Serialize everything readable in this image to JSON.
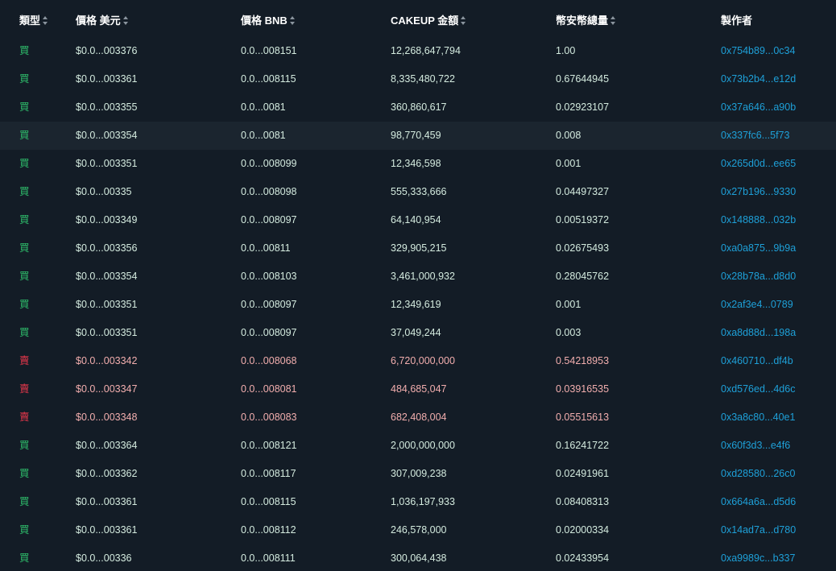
{
  "header": {
    "type": "類型",
    "price_usd": "價格 美元",
    "price_bnb": "價格 BNB",
    "amount": "CAKEUP 金額",
    "total_bnb": "幣安幣總量",
    "maker": "製作者"
  },
  "colors": {
    "background": "#131c26",
    "row_highlight": "#1b252f",
    "buy": "#2ebd6b",
    "buy_text": "#d4ebdf",
    "sell": "#e0364a",
    "sell_text": "#f2aeae",
    "link": "#1ea0d8"
  },
  "icons": {
    "sort": "sort-arrows-icon"
  },
  "trades": [
    {
      "side": "buy",
      "type": "買",
      "price_usd": "$0.0...003376",
      "price_bnb": "0.0...008151",
      "amount": "12,268,647,794",
      "total_bnb": "1.00",
      "maker": "0x754b89...0c34"
    },
    {
      "side": "buy",
      "type": "買",
      "price_usd": "$0.0...003361",
      "price_bnb": "0.0...008115",
      "amount": "8,335,480,722",
      "total_bnb": "0.67644945",
      "maker": "0x73b2b4...e12d"
    },
    {
      "side": "buy",
      "type": "買",
      "price_usd": "$0.0...003355",
      "price_bnb": "0.0...0081",
      "amount": "360,860,617",
      "total_bnb": "0.02923107",
      "maker": "0x37a646...a90b"
    },
    {
      "side": "buy",
      "type": "買",
      "price_usd": "$0.0...003354",
      "price_bnb": "0.0...0081",
      "amount": "98,770,459",
      "total_bnb": "0.008",
      "maker": "0x337fc6...5f73",
      "highlight": true
    },
    {
      "side": "buy",
      "type": "買",
      "price_usd": "$0.0...003351",
      "price_bnb": "0.0...008099",
      "amount": "12,346,598",
      "total_bnb": "0.001",
      "maker": "0x265d0d...ee65"
    },
    {
      "side": "buy",
      "type": "買",
      "price_usd": "$0.0...00335",
      "price_bnb": "0.0...008098",
      "amount": "555,333,666",
      "total_bnb": "0.04497327",
      "maker": "0x27b196...9330"
    },
    {
      "side": "buy",
      "type": "買",
      "price_usd": "$0.0...003349",
      "price_bnb": "0.0...008097",
      "amount": "64,140,954",
      "total_bnb": "0.00519372",
      "maker": "0x148888...032b"
    },
    {
      "side": "buy",
      "type": "買",
      "price_usd": "$0.0...003356",
      "price_bnb": "0.0...00811",
      "amount": "329,905,215",
      "total_bnb": "0.02675493",
      "maker": "0xa0a875...9b9a"
    },
    {
      "side": "buy",
      "type": "買",
      "price_usd": "$0.0...003354",
      "price_bnb": "0.0...008103",
      "amount": "3,461,000,932",
      "total_bnb": "0.28045762",
      "maker": "0x28b78a...d8d0"
    },
    {
      "side": "buy",
      "type": "買",
      "price_usd": "$0.0...003351",
      "price_bnb": "0.0...008097",
      "amount": "12,349,619",
      "total_bnb": "0.001",
      "maker": "0x2af3e4...0789"
    },
    {
      "side": "buy",
      "type": "買",
      "price_usd": "$0.0...003351",
      "price_bnb": "0.0...008097",
      "amount": "37,049,244",
      "total_bnb": "0.003",
      "maker": "0xa8d88d...198a"
    },
    {
      "side": "sell",
      "type": "賣",
      "price_usd": "$0.0...003342",
      "price_bnb": "0.0...008068",
      "amount": "6,720,000,000",
      "total_bnb": "0.54218953",
      "maker": "0x460710...df4b"
    },
    {
      "side": "sell",
      "type": "賣",
      "price_usd": "$0.0...003347",
      "price_bnb": "0.0...008081",
      "amount": "484,685,047",
      "total_bnb": "0.03916535",
      "maker": "0xd576ed...4d6c"
    },
    {
      "side": "sell",
      "type": "賣",
      "price_usd": "$0.0...003348",
      "price_bnb": "0.0...008083",
      "amount": "682,408,004",
      "total_bnb": "0.05515613",
      "maker": "0x3a8c80...40e1"
    },
    {
      "side": "buy",
      "type": "買",
      "price_usd": "$0.0...003364",
      "price_bnb": "0.0...008121",
      "amount": "2,000,000,000",
      "total_bnb": "0.16241722",
      "maker": "0x60f3d3...e4f6"
    },
    {
      "side": "buy",
      "type": "買",
      "price_usd": "$0.0...003362",
      "price_bnb": "0.0...008117",
      "amount": "307,009,238",
      "total_bnb": "0.02491961",
      "maker": "0xd28580...26c0"
    },
    {
      "side": "buy",
      "type": "買",
      "price_usd": "$0.0...003361",
      "price_bnb": "0.0...008115",
      "amount": "1,036,197,933",
      "total_bnb": "0.08408313",
      "maker": "0x664a6a...d5d6"
    },
    {
      "side": "buy",
      "type": "買",
      "price_usd": "$0.0...003361",
      "price_bnb": "0.0...008112",
      "amount": "246,578,000",
      "total_bnb": "0.02000334",
      "maker": "0x14ad7a...d780"
    },
    {
      "side": "buy",
      "type": "買",
      "price_usd": "$0.0...00336",
      "price_bnb": "0.0...008111",
      "amount": "300,064,438",
      "total_bnb": "0.02433954",
      "maker": "0xa9989c...b337"
    }
  ]
}
